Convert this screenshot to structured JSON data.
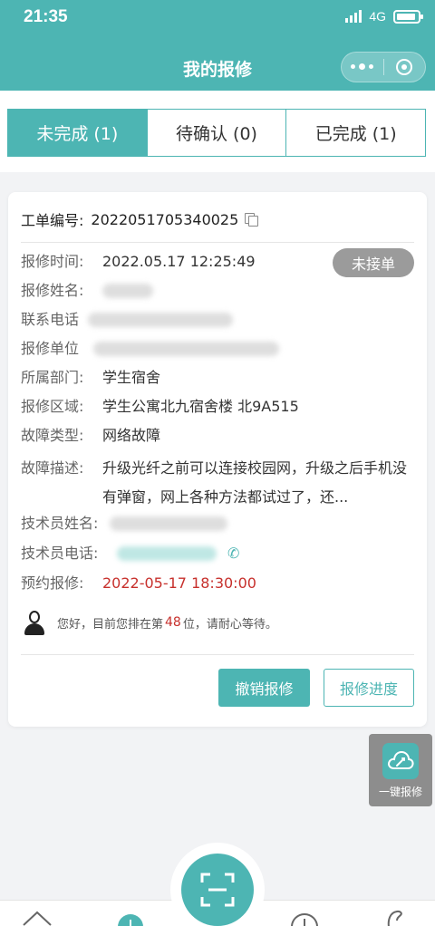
{
  "status_bar": {
    "time": "21:35",
    "network": "4G"
  },
  "header": {
    "title": "我的报修"
  },
  "tabs": [
    {
      "label": "未完成 (1)",
      "active": true
    },
    {
      "label": "待确认 (0)",
      "active": false
    },
    {
      "label": "已完成 (1)",
      "active": false
    }
  ],
  "order": {
    "number_label": "工单编号:",
    "number": "2022051705340025",
    "status_badge": "未接单",
    "fields": {
      "time": {
        "label": "报修时间:",
        "value": "2022.05.17 12:25:49"
      },
      "name": {
        "label": "报修姓名:",
        "value": ""
      },
      "contact": {
        "label": "联系电话:",
        "value": ""
      },
      "unit": {
        "label": "报修单位:",
        "value": ""
      },
      "department": {
        "label": "所属部门:",
        "value": "学生宿舍"
      },
      "area": {
        "label": "报修区域:",
        "value": "学生公寓北九宿舍楼 北9A515"
      },
      "fault_type": {
        "label": "故障类型:",
        "value": "网络故障"
      },
      "fault_desc": {
        "label": "故障描述:",
        "value": "升级光纤之前可以连接校园网，升级之后手机没有弹窗，网上各种方法都试过了，还..."
      },
      "tech_name": {
        "label": "技术员姓名:",
        "value": ""
      },
      "tech_phone": {
        "label": "技术员电话:",
        "value": ""
      },
      "appointment": {
        "label": "预约报修:",
        "value": "2022-05-17 18:30:00"
      }
    },
    "queue": {
      "prefix": "您好，目前您排在第",
      "position": "48",
      "suffix": "位，请耐心等待。"
    },
    "buttons": {
      "cancel": "撤销报修",
      "progress": "报修进度"
    }
  },
  "floating_button": {
    "label": "一键报修"
  },
  "colors": {
    "accent": "#4db5b3",
    "badge": "#9b9b9b",
    "alert": "#c7302c"
  },
  "icons": [
    "signal-icon",
    "battery-icon",
    "more-icon",
    "close-circle-icon",
    "copy-icon",
    "phone-icon",
    "user-avatar-icon",
    "cloud-repair-icon",
    "scan-icon",
    "home-icon",
    "add-icon",
    "info-icon",
    "profile-icon"
  ]
}
